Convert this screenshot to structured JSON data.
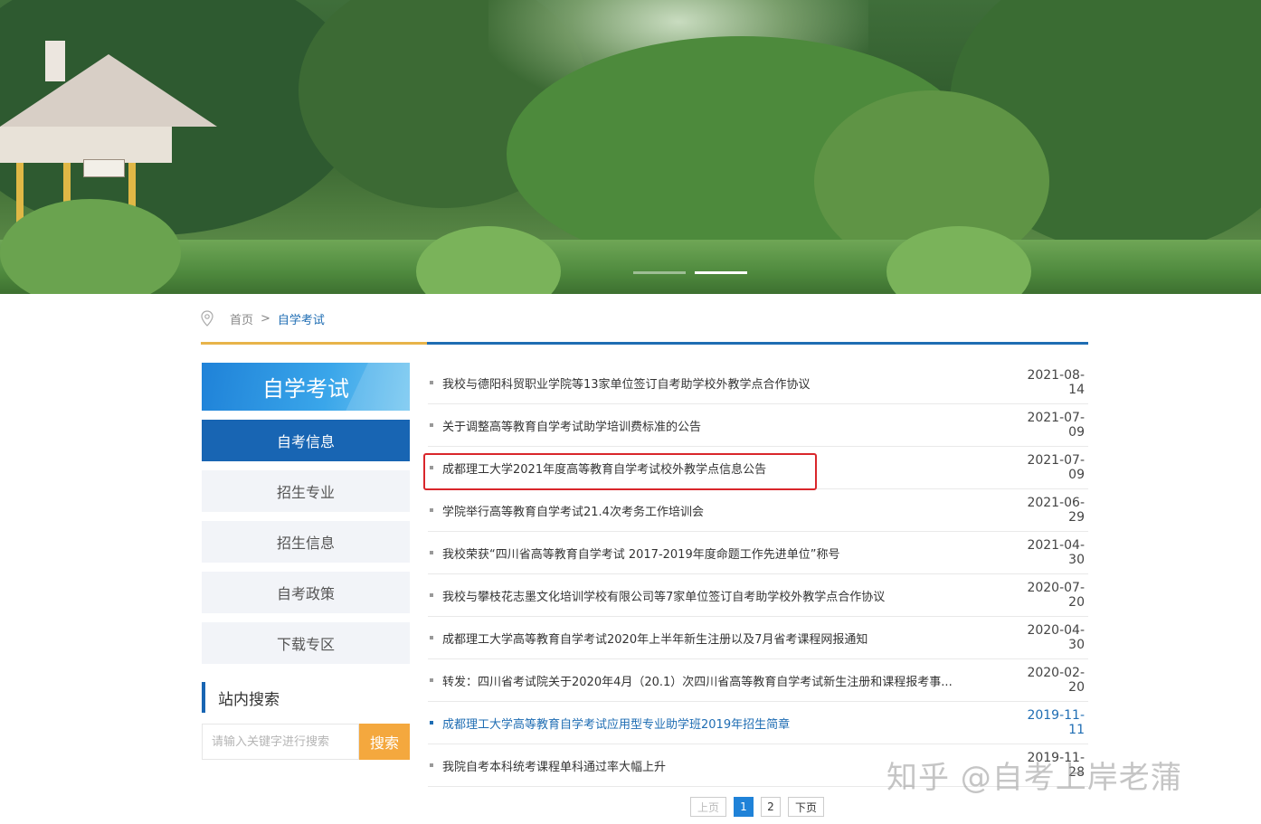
{
  "breadcrumb": {
    "home": "首页",
    "separator": ">",
    "current": "自学考试"
  },
  "sidebar": {
    "title": "自学考试",
    "items": [
      {
        "label": "自考信息",
        "active": true
      },
      {
        "label": "招生专业"
      },
      {
        "label": "招生信息"
      },
      {
        "label": "自考政策"
      },
      {
        "label": "下载专区"
      }
    ]
  },
  "search": {
    "heading": "站内搜索",
    "placeholder": "请输入关键字进行搜索",
    "button": "搜索"
  },
  "news": [
    {
      "title": "我校与德阳科贸职业学院等13家单位签订自考助学校外教学点合作协议",
      "date": "2021-08-14"
    },
    {
      "title": "关于调整高等教育自学考试助学培训费标准的公告",
      "date": "2021-07-09"
    },
    {
      "title": "成都理工大学2021年度高等教育自学考试校外教学点信息公告",
      "date": "2021-07-09"
    },
    {
      "title": "学院举行高等教育自学考试21.4次考务工作培训会",
      "date": "2021-06-29"
    },
    {
      "title": "我校荣获“四川省高等教育自学考试 2017-2019年度命题工作先进单位”称号",
      "date": "2021-04-30"
    },
    {
      "title": "我校与攀枝花志墨文化培训学校有限公司等7家单位签订自考助学校外教学点合作协议",
      "date": "2020-07-20"
    },
    {
      "title": "成都理工大学高等教育自学考试2020年上半年新生注册以及7月省考课程网报通知",
      "date": "2020-04-30"
    },
    {
      "title": "转发：四川省考试院关于2020年4月（20.1）次四川省高等教育自学考试新生注册和课程报考事...",
      "date": "2020-02-20"
    },
    {
      "title": "成都理工大学高等教育自学考试应用型专业助学班2019年招生简章",
      "date": "2019-11-11"
    },
    {
      "title": "我院自考本科统考课程单科通过率大幅上升",
      "date": "2019-11-28"
    }
  ],
  "pagination": {
    "prev": "上页",
    "pages": [
      "1",
      "2"
    ],
    "current": "1",
    "next": "下页"
  },
  "watermark": "知乎 @自考上岸老蒲",
  "colors": {
    "primary": "#1865b3",
    "accent": "#e8b44a",
    "search_button": "#f4a83e",
    "highlight_box": "#d9262b"
  }
}
